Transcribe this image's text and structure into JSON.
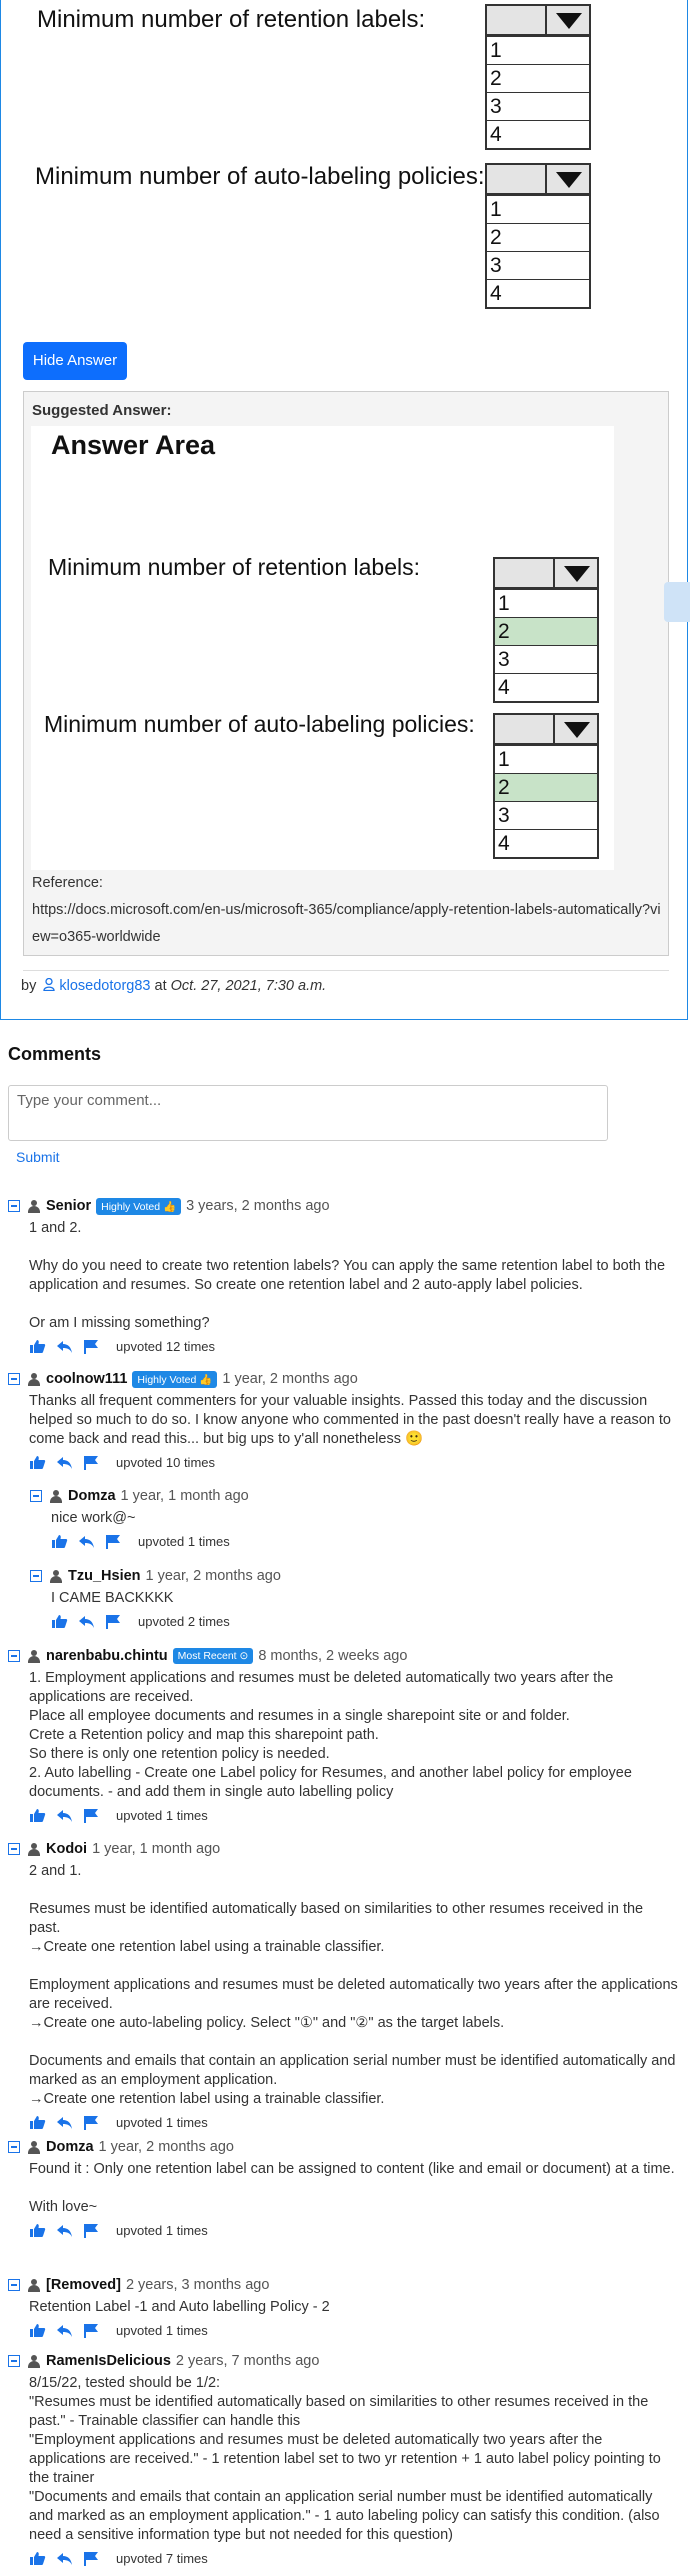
{
  "question": {
    "label_retention": "Minimum number of retention labels:",
    "label_auto": "Minimum number of auto-labeling policies:",
    "options": [
      "1",
      "2",
      "3",
      "4"
    ],
    "hide_answer_label": "Hide Answer",
    "suggested_title": "Suggested Answer:",
    "answer_area_title": "Answer Area",
    "selected_retention": "2",
    "selected_auto": "2",
    "reference_label": "Reference:",
    "reference_url": "https://docs.microsoft.com/en-us/microsoft-365/compliance/apply-retention-labels-automatically?view=o365-worldwide",
    "by": "by",
    "author": "klosedotorg83",
    "at": "at",
    "date": "Oct. 27, 2021, 7:30 a.m."
  },
  "comments_section": {
    "heading": "Comments",
    "placeholder": "Type your comment...",
    "submit_label": "Submit"
  },
  "comments": [
    {
      "user": "Senior",
      "badge": "Highly Voted 👍",
      "time": "3 years, 2 months ago",
      "body": "1 and 2.\n\nWhy do you need to create two retention labels? You can apply the same retention label to both the application and resumes. So create one retention label and 2 auto-apply label policies.\n\nOr am I missing something?",
      "votes": "upvoted 12 times"
    },
    {
      "user": "coolnow111",
      "badge": "Highly Voted 👍",
      "time": "1 year, 2 months ago",
      "body": "Thanks all frequent commenters for your valuable insights. Passed this today and the discussion helped so much to do so. I know anyone who commented in the past doesn't really have a reason to come back and read this... but big ups to y'all nonetheless 🙂",
      "votes": "upvoted 10 times"
    },
    {
      "user": "Domza",
      "badge": "",
      "time": "1 year, 1 month ago",
      "body": "nice work@~",
      "votes": "upvoted 1 times"
    },
    {
      "user": "Tzu_Hsien",
      "badge": "",
      "time": "1 year, 2 months ago",
      "body": "I CAME BACKKKK",
      "votes": "upvoted 2 times"
    },
    {
      "user": "narenbabu.chintu",
      "badge": "Most Recent ⊙",
      "time": "8 months, 2 weeks ago",
      "body": "1. Employment applications and resumes must be deleted automatically two years after the applications are received.\nPlace all employee documents and resumes in a single sharepoint site or and folder.\nCrete a Retention policy and map this sharepoint path.\nSo there is only one retention policy is needed.\n2. Auto labelling - Create one Label policy for Resumes, and another label policy for employee documents. - and add them in single auto labelling policy",
      "votes": "upvoted 1 times"
    },
    {
      "user": "Kodoi",
      "badge": "",
      "time": "1 year, 1 month ago",
      "body": "2 and 1.\n\nResumes must be identified automatically based on similarities to other resumes received in the past.\n→Create one retention label using a trainable classifier.\n\nEmployment applications and resumes must be deleted automatically two years after the applications are received.\n→Create one auto-labeling policy. Select \"①\" and \"②\" as the target labels.\n\nDocuments and emails that contain an application serial number must be identified automatically and marked as an employment application.\n→Create one retention label using a trainable classifier.",
      "votes": "upvoted 1 times"
    },
    {
      "user": "Domza",
      "badge": "",
      "time": "1 year, 2 months ago",
      "body": "Found it : Only one retention label can be assigned to content (like and email or document) at a time.\n\nWith love~",
      "votes": "upvoted 1 times"
    },
    {
      "user": "[Removed]",
      "badge": "",
      "time": "2 years, 3 months ago",
      "body": "Retention Label -1 and Auto labelling Policy - 2",
      "votes": "upvoted 1 times"
    },
    {
      "user": "RamenIsDelicious",
      "badge": "",
      "time": "2 years, 7 months ago",
      "body": "8/15/22, tested should be 1/2:\n\"Resumes must be identified automatically based on similarities to other resumes received in the past.\" - Trainable classifier can handle this\n\"Employment applications and resumes must be deleted automatically two years after the applications are received.\" - 1 retention label set to two yr retention + 1 auto label policy pointing to the trainer\n\"Documents and emails that contain an application serial number must be identified automatically and marked as an employment application.\" - 1 auto labeling policy can satisfy this condition. (also need a sensitive information type but not needed for this question)",
      "votes": "upvoted 7 times"
    }
  ]
}
